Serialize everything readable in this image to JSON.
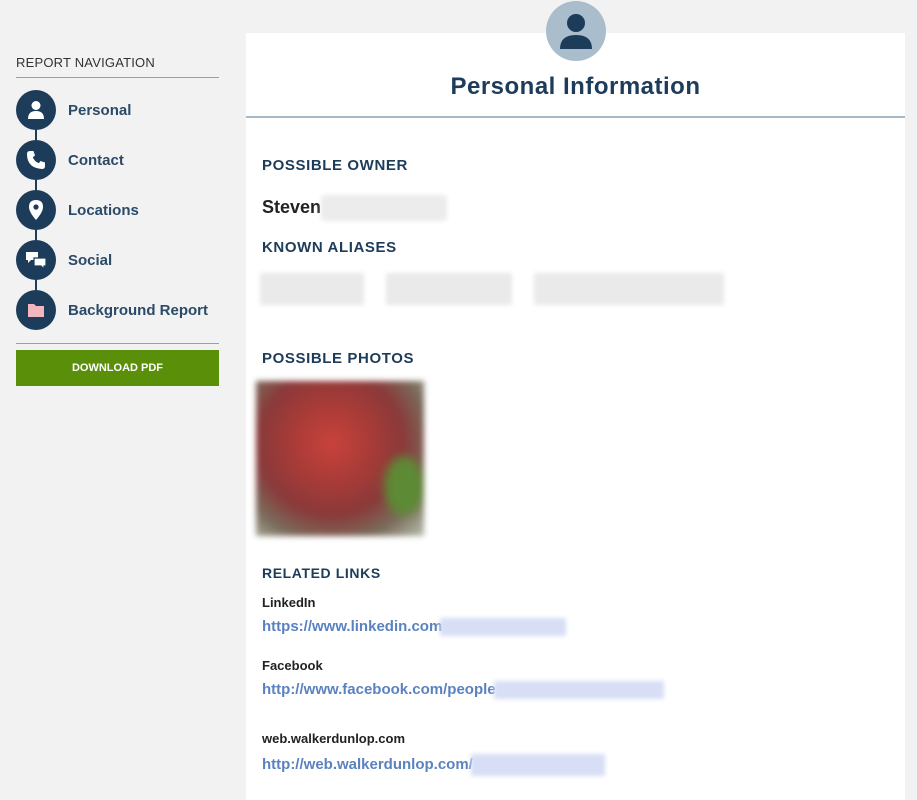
{
  "sidebar": {
    "title": "REPORT NAVIGATION",
    "items": [
      {
        "label": "Personal",
        "icon": "person-icon"
      },
      {
        "label": "Contact",
        "icon": "phone-icon"
      },
      {
        "label": "Locations",
        "icon": "map-pin-icon"
      },
      {
        "label": "Social",
        "icon": "chat-bubbles-icon"
      },
      {
        "label": "Background Report",
        "icon": "folder-icon"
      }
    ],
    "download_label": "DOWNLOAD PDF"
  },
  "main": {
    "title": "Personal Information",
    "owner_heading": "POSSIBLE OWNER",
    "owner_name": "Steven",
    "aliases_heading": "KNOWN ALIASES",
    "photos_heading": "POSSIBLE PHOTOS",
    "links_heading": "RELATED LINKS",
    "links": [
      {
        "label": "LinkedIn",
        "url": "https://www.linkedin.com"
      },
      {
        "label": "Facebook",
        "url": "http://www.facebook.com/people"
      },
      {
        "label": "web.walkerdunlop.com",
        "url": "http://web.walkerdunlop.com/"
      }
    ]
  },
  "colors": {
    "navy": "#1d3c5a",
    "download_button": "#5a8f0a",
    "link": "#5b82c0",
    "avatar_bg": "#a9bdcc"
  }
}
